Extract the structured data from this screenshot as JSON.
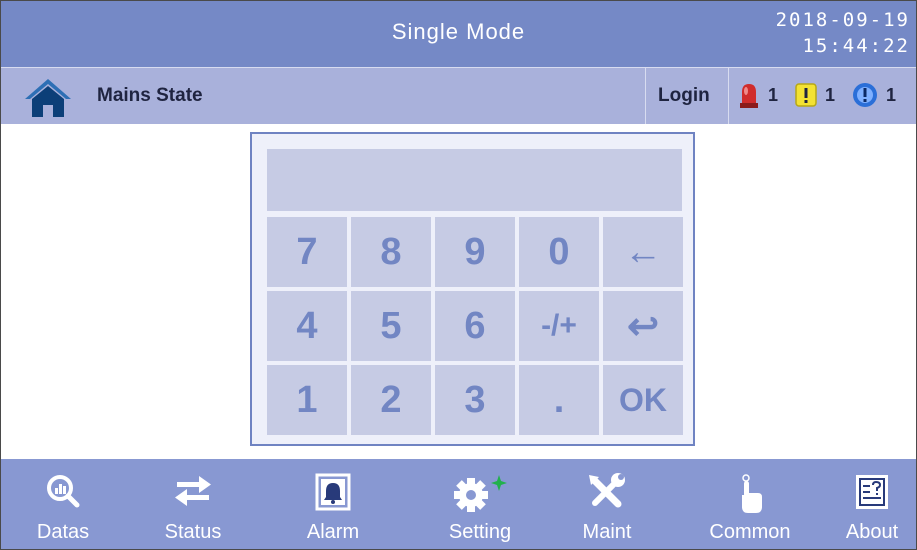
{
  "header": {
    "title": "Single Mode",
    "date": "2018-09-19",
    "time": "15:44:22"
  },
  "status": {
    "state": "Mains State",
    "login": "Login",
    "indicators": [
      {
        "icon": "alarm-light-icon",
        "count": "1",
        "color": "#d02c2c"
      },
      {
        "icon": "warning-icon",
        "count": "1",
        "color": "#f3e233"
      },
      {
        "icon": "info-icon",
        "count": "1",
        "color": "#2b6fd8"
      }
    ]
  },
  "keypad": {
    "display_value": "",
    "keys": [
      "7",
      "8",
      "9",
      "0",
      "←",
      "4",
      "5",
      "6",
      "-/+",
      "↩",
      "1",
      "2",
      "3",
      ".",
      "OK"
    ]
  },
  "nav": [
    {
      "label": "Datas",
      "icon": "datas-icon"
    },
    {
      "label": "Status",
      "icon": "status-icon"
    },
    {
      "label": "Alarm",
      "icon": "alarm-icon"
    },
    {
      "label": "Setting",
      "icon": "setting-icon"
    },
    {
      "label": "Maint",
      "icon": "maint-icon"
    },
    {
      "label": "Common",
      "icon": "common-icon"
    },
    {
      "label": "About",
      "icon": "about-icon"
    }
  ],
  "colors": {
    "title_bar": "#7589c6",
    "status_bar": "#a9b1db",
    "nav_bar": "#8898d2",
    "key_bg": "#c6cbe4",
    "key_text": "#7286c3",
    "keypad_border": "#6f83c2"
  }
}
